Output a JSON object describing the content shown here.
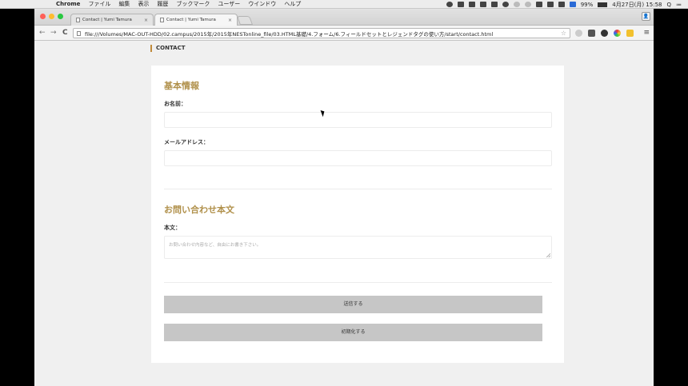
{
  "menubar": {
    "apple": "",
    "app_name": "Chrome",
    "items": [
      "ファイル",
      "編集",
      "表示",
      "履歴",
      "ブックマーク",
      "ユーザー",
      "ウインドウ",
      "ヘルプ"
    ],
    "battery": "99%",
    "datetime": "4月27日(月) 15:58",
    "search_icon": "Q",
    "list_icon": "≔"
  },
  "browser": {
    "tabs": [
      {
        "title": "Contact | Yumi Tamura",
        "close": "×"
      },
      {
        "title": "Contact | Yumi Tamura",
        "close": "×"
      }
    ],
    "profile_icon": "👤",
    "back": "←",
    "forward": "→",
    "reload": "C",
    "url": "file:///Volumes/MAC-OUT-HDD/02.campus/2015年/2015年NESTonline_file/03.HTML基礎/4.フォーム/6.フィールドセットとレジェンドタグの使い方/start/contact.html",
    "star": "☆",
    "menu": "≡"
  },
  "page": {
    "heading": "CONTACT",
    "fieldset1": {
      "legend": "基本情報",
      "name_label": "お名前：",
      "email_label": "メールアドレス："
    },
    "fieldset2": {
      "legend": "お問い合わせ本文",
      "body_label": "本文：",
      "body_placeholder": "お問い合わせ内容など、自由にお書き下さい。"
    },
    "submit_label": "送信する",
    "reset_label": "初期化する"
  },
  "colors": {
    "accent": "#b0904a",
    "heading_bar": "#c08a3a",
    "button_bg": "#c6c6c6",
    "page_bg": "#f0f0f0"
  }
}
